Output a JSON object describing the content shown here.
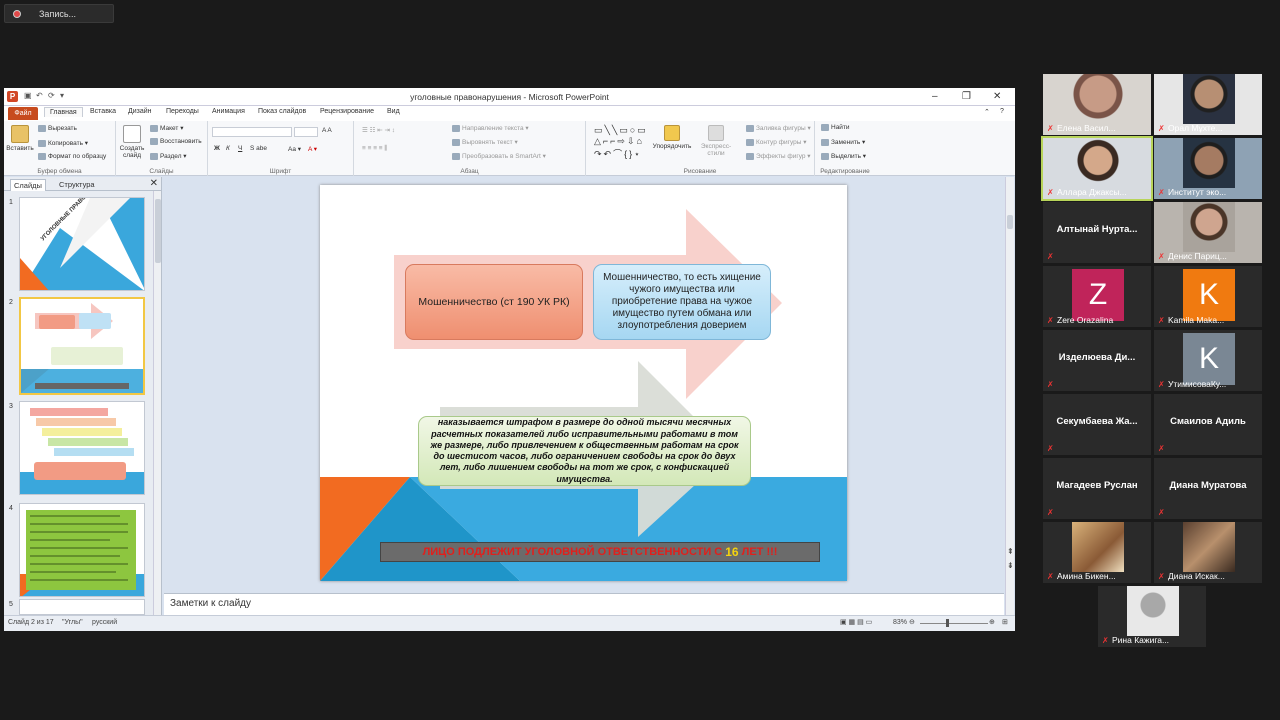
{
  "recording": {
    "label": "Запись..."
  },
  "window": {
    "title": "уголовные правонарушения - Microsoft PowerPoint",
    "tabs": [
      "Файл",
      "Главная",
      "Вставка",
      "Дизайн",
      "Переходы",
      "Анимация",
      "Показ слайдов",
      "Рецензирование",
      "Вид"
    ],
    "active_tab": "Главная"
  },
  "ribbon": {
    "clipboard": {
      "paste": "Вставить",
      "cut": "Вырезать",
      "copy": "Копировать",
      "format_painter": "Формат по образцу",
      "label": "Буфер обмена"
    },
    "slides": {
      "new_slide": "Создать слайд",
      "layout": "Макет",
      "reset": "Восстановить",
      "section": "Раздел",
      "label": "Слайды"
    },
    "font": {
      "label": "Шрифт"
    },
    "paragraph": {
      "text_direction": "Направление текста",
      "align_text": "Выровнять текст",
      "smartart": "Преобразовать в SmartArt",
      "label": "Абзац"
    },
    "drawing": {
      "arrange": "Упорядочить",
      "quick_styles": "Экспресс-стили",
      "shape_fill": "Заливка фигуры",
      "shape_outline": "Контур фигуры",
      "shape_effects": "Эффекты фигур",
      "label": "Рисование"
    },
    "editing": {
      "find": "Найти",
      "replace": "Заменить",
      "select": "Выделить",
      "label": "Редактирование"
    }
  },
  "side_panel": {
    "tabs": [
      "Слайды",
      "Структура"
    ],
    "thumbnails": [
      {
        "num": "1",
        "title": "УГОЛОВНЫЕ ПРАВОНАРУШЕНИЯ"
      },
      {
        "num": "2",
        "title": ""
      },
      {
        "num": "3",
        "title": ""
      },
      {
        "num": "4",
        "title": ""
      },
      {
        "num": "5",
        "title": ""
      }
    ]
  },
  "slide": {
    "box_left": "Мошенничество (ст 190 УК РК)",
    "box_right": "Мошенничество, то есть хищение чужого имущества или приобретение права на чужое имущество путем обмана или злоупотребления доверием",
    "penalty": "наказывается штрафом в размере до одной тысячи месячных расчетных показателей либо исправительными работами в том же размере, либо привлечением к общественным работам на срок до шестисот часов, либо ограничением свободы на срок до двух лет, либо лишением свободы на тот же срок, с конфискацией имущества.",
    "banner_prefix": "ЛИЦО ПОДЛЕЖИТ УГОЛОВНОЙ ОТВЕТСТВЕННОСТИ С ",
    "banner_age": "16",
    "banner_suffix": " ЛЕТ !!!"
  },
  "notes": {
    "placeholder": "Заметки к слайду"
  },
  "status": {
    "slide_info": "Слайд 2 из 17",
    "theme": "\"Углы\"",
    "language": "русский",
    "zoom": "83%"
  },
  "participants": [
    {
      "name": "Елена Васил...",
      "type": "video"
    },
    {
      "name": "Орал Мұхте...",
      "type": "video"
    },
    {
      "name": "Аллара Джаксы...",
      "type": "video"
    },
    {
      "name": "Институт эко...",
      "type": "video"
    },
    {
      "name": "Алтынай  Нурта...",
      "type": "name"
    },
    {
      "name": "Денис Париц...",
      "type": "video"
    },
    {
      "name": "Zere Orazalina",
      "type": "avatar",
      "letter": "Z",
      "color": "#c0245a"
    },
    {
      "name": "Kamila Maka...",
      "type": "avatar",
      "letter": "K",
      "color": "#f07a10"
    },
    {
      "name": "Изделюева  Ди...",
      "type": "name"
    },
    {
      "name": "УтимисоваКу...",
      "type": "avatar",
      "letter": "K",
      "color": "#7a8794"
    },
    {
      "name": "Секумбаева  Жа...",
      "type": "name"
    },
    {
      "name": "Смаилов Адиль",
      "type": "name"
    },
    {
      "name": "Магадеев Руслан",
      "type": "name"
    },
    {
      "name": "Диана Муратова",
      "type": "name"
    },
    {
      "name": "Амина Бикен...",
      "type": "video"
    },
    {
      "name": "Диана Искак...",
      "type": "video"
    },
    {
      "name": "Рина Кажига...",
      "type": "video"
    }
  ]
}
